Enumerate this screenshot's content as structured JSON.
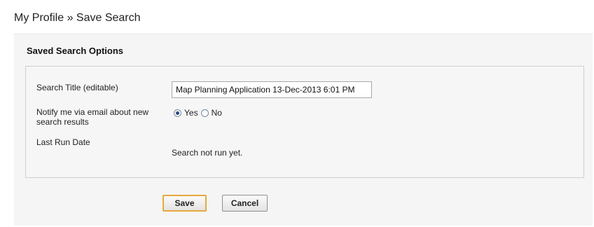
{
  "header": {
    "title": "My Profile » Save Search"
  },
  "section": {
    "title": "Saved Search Options"
  },
  "form": {
    "search_title_label": "Search Title (editable)",
    "search_title_value": "Map Planning Application 13-Dec-2013 6:01 PM",
    "notify_label_line1": "Notify me via email about new",
    "notify_label_line2": "search results",
    "notify_options": [
      {
        "label": "Yes",
        "checked": true
      },
      {
        "label": "No",
        "checked": false
      }
    ],
    "last_run_label": "Last Run Date",
    "last_run_value": "Search not run yet."
  },
  "actions": {
    "save_label": "Save",
    "cancel_label": "Cancel"
  },
  "colors": {
    "save_border": "#e8a93c",
    "panel_bg": "#f5f5f5",
    "box_border": "#cfcfcf"
  }
}
